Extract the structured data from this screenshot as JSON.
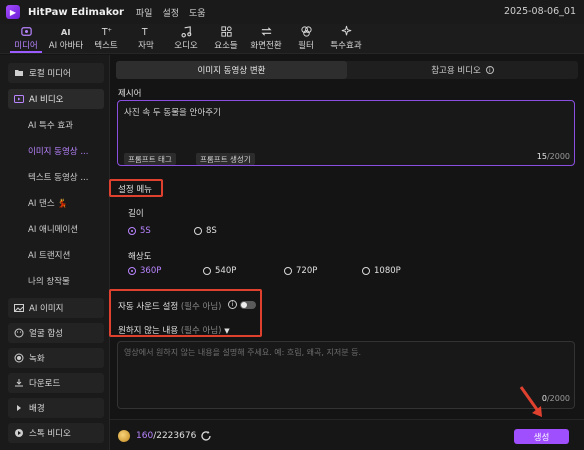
{
  "titlebar": {
    "app_name": "HitPaw Edimakor",
    "menus": [
      "파일",
      "설정",
      "도움"
    ],
    "date": "2025-08-06_01"
  },
  "toolbar": {
    "tools": [
      {
        "label": "미디어",
        "icon": "media-icon",
        "active": true
      },
      {
        "label": "AI 아바타",
        "icon": "ai-avatar-icon"
      },
      {
        "label": "텍스트",
        "icon": "text-icon"
      },
      {
        "label": "자막",
        "icon": "subtitle-icon"
      },
      {
        "label": "오디오",
        "icon": "audio-icon"
      },
      {
        "label": "요소들",
        "icon": "elements-icon"
      },
      {
        "label": "화면전환",
        "icon": "transition-icon"
      },
      {
        "label": "필터",
        "icon": "filter-icon"
      },
      {
        "label": "특수효과",
        "icon": "effects-icon"
      }
    ]
  },
  "sidebar": {
    "local_media": "로컬 미디어",
    "ai_video": "AI 비디오",
    "sub_items": [
      "AI 특수 효과",
      "이미지 동영상 ...",
      "텍스트 동영상 ...",
      "AI 댄스 💃",
      "AI 애니메이션",
      "AI 트랜지션",
      "나의 창작물"
    ],
    "ai_image": "AI 이미지",
    "face_merge": "얼굴 합성",
    "record": "녹화",
    "download": "다운로드",
    "background": "배경",
    "stock_video": "스톡 비디오"
  },
  "main": {
    "tabs": [
      "이미지 동영상 변환",
      "참고용 비디오"
    ],
    "prompt_label": "제시어",
    "prompt_value": "사진 속 두 동물을 안아주기",
    "chip_tag": "프롬프트 태그",
    "chip_gen": "프롬프트 생성기",
    "prompt_count": "15",
    "prompt_max": "/2000",
    "settings_menu": "설정 메뉴",
    "length_label": "길이",
    "length_options": [
      "5S",
      "8S"
    ],
    "resolution_label": "해상도",
    "resolution_options": [
      "360P",
      "540P",
      "720P",
      "1080P"
    ],
    "auto_sound": "자동 사운드 설정",
    "optional": "(필수 아님)",
    "negative_label": "원하지 않는 내용",
    "negative_placeholder": "영상에서 원하지 않는 내용을 설명해 주세요. 예: 흐림, 왜곡, 지저분 등.",
    "neg_count": "0",
    "neg_max": "/2000",
    "credits_used": "160",
    "credits_total": "/2223676",
    "generate": "생성"
  },
  "colors": {
    "accent": "#a04fff",
    "highlight": "#e0412f"
  }
}
